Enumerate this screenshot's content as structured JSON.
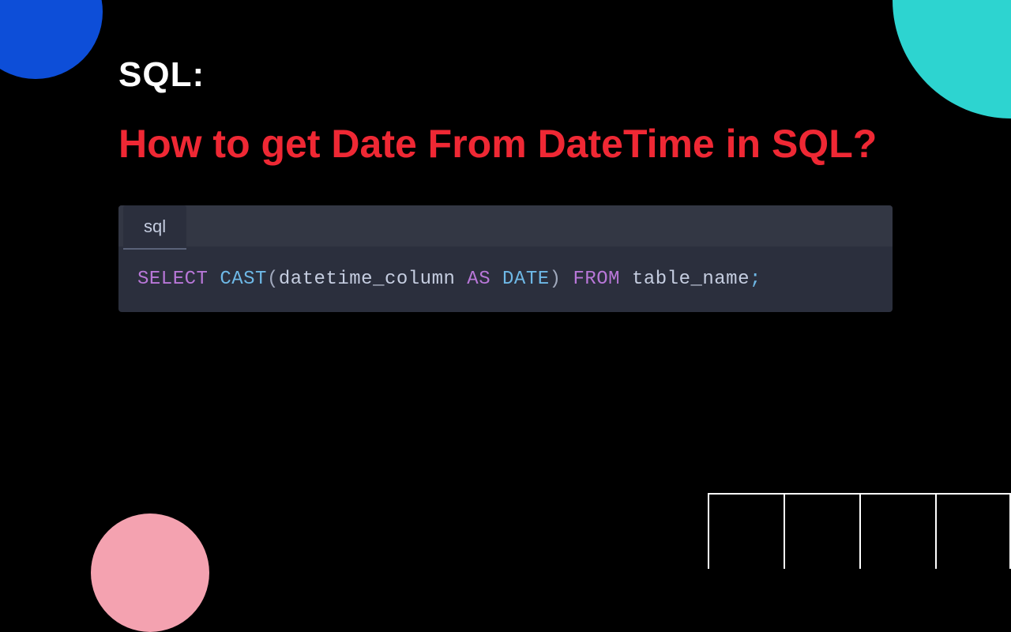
{
  "heading": {
    "prefix": "SQL:",
    "question": "How to get Date From DateTime in SQL?"
  },
  "code": {
    "tab_label": "sql",
    "tokens": {
      "select": "SELECT",
      "cast": "CAST",
      "open_paren": "(",
      "column": "datetime_column",
      "as": "AS",
      "date": "DATE",
      "close_paren": ")",
      "from": "FROM",
      "table": "table_name",
      "semi": ";"
    }
  },
  "colors": {
    "background": "#000000",
    "accent_blue": "#0d4ed8",
    "accent_cyan": "#2dd4d0",
    "accent_pink": "#f4a2b0",
    "title_white": "#ffffff",
    "title_red": "#ef2834",
    "code_bg": "#2b2f3d",
    "code_tab_bg": "#333744",
    "code_keyword": "#b877d8",
    "code_func": "#6eb8e6",
    "code_plain": "#c5cde0"
  }
}
